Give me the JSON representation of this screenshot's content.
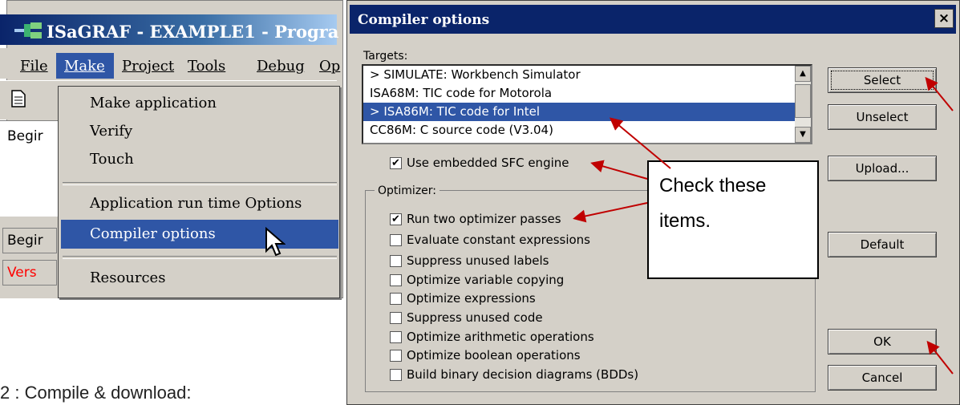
{
  "ide": {
    "title": "ISaGRAF - EXAMPLE1 - Progra",
    "menu": [
      "File",
      "Make",
      "Project",
      "Tools",
      "Debug",
      "Op"
    ],
    "pane_line": "Begir",
    "status_lines": [
      "Begir",
      "Vers"
    ]
  },
  "make_menu": {
    "items": [
      "Make application",
      "Verify",
      "Touch",
      "Application run time Options",
      "Compiler options",
      "Resources"
    ],
    "highlighted": "Compiler options"
  },
  "caption": "2 : Compile & download:",
  "dialog": {
    "title": "Compiler options",
    "close_label": "×",
    "targets_label": "Targets:",
    "targets": [
      "> SIMULATE: Workbench Simulator",
      "ISA68M: TIC code for Motorola",
      "> ISA86M: TIC code for Intel",
      "CC86M: C source code (V3.04)"
    ],
    "selected_target_index": 2,
    "embedded_sfc": {
      "label": "Use embedded SFC engine",
      "checked": true
    },
    "optimizer_label": "Optimizer:",
    "options": [
      {
        "label": "Run two optimizer passes",
        "checked": true
      },
      {
        "label": "Evaluate constant expressions",
        "checked": false
      },
      {
        "label": "Suppress unused labels",
        "checked": false
      },
      {
        "label": "Optimize variable copying",
        "checked": false
      },
      {
        "label": "Optimize expressions",
        "checked": false
      },
      {
        "label": "Suppress unused code",
        "checked": false
      },
      {
        "label": "Optimize arithmetic operations",
        "checked": false
      },
      {
        "label": "Optimize boolean operations",
        "checked": false
      },
      {
        "label": "Build binary decision diagrams (BDDs)",
        "checked": false
      }
    ],
    "buttons": {
      "select": "Select",
      "unselect": "Unselect",
      "upload": "Upload...",
      "default": "Default",
      "ok": "OK",
      "cancel": "Cancel"
    }
  },
  "callout": {
    "lines": [
      "Check these",
      "items."
    ]
  },
  "colors": {
    "highlight": "#2f56a6",
    "arrow": "#c00000",
    "status_red": "#ff0000"
  }
}
